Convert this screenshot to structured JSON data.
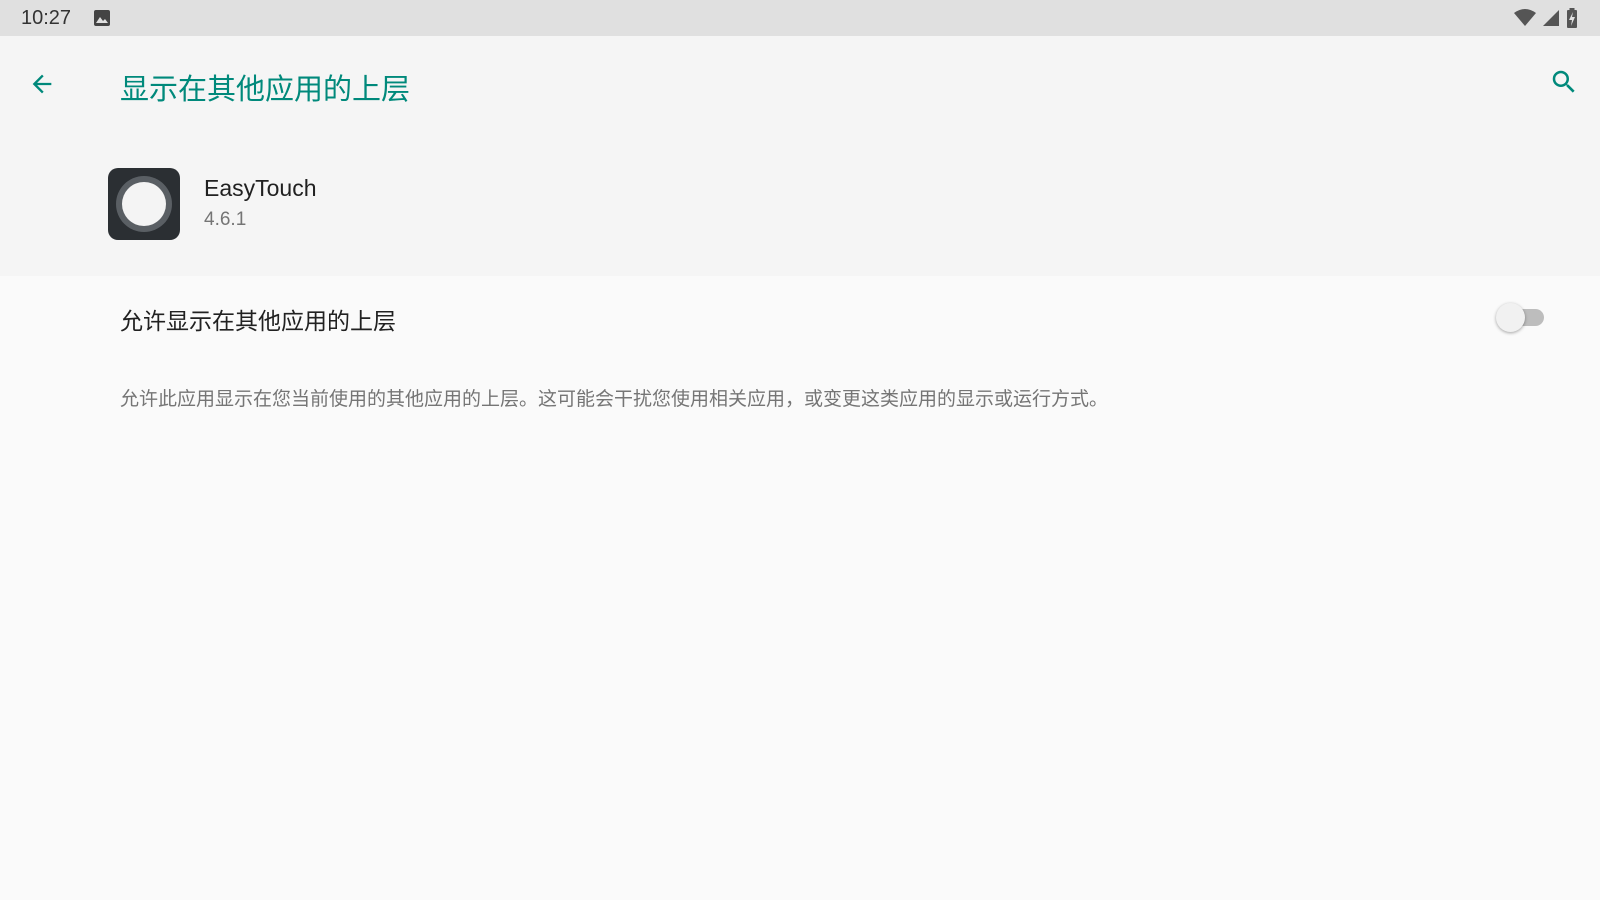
{
  "status_bar": {
    "time": "10:27",
    "icons": [
      "image-icon",
      "wifi-icon",
      "signal-icon",
      "battery-charging-icon"
    ]
  },
  "app_bar": {
    "title": "显示在其他应用的上层",
    "back_icon": "arrow-back-icon",
    "search_icon": "search-icon",
    "accent_color": "#00897b"
  },
  "app_header": {
    "name": "EasyTouch",
    "version": "4.6.1",
    "icon": "easytouch-app-icon"
  },
  "preference": {
    "title": "允许显示在其他应用的上层",
    "toggle_on": false
  },
  "description": "允许此应用显示在您当前使用的其他应用的上层。这可能会干扰您使用相关应用，或变更这类应用的显示或运行方式。"
}
